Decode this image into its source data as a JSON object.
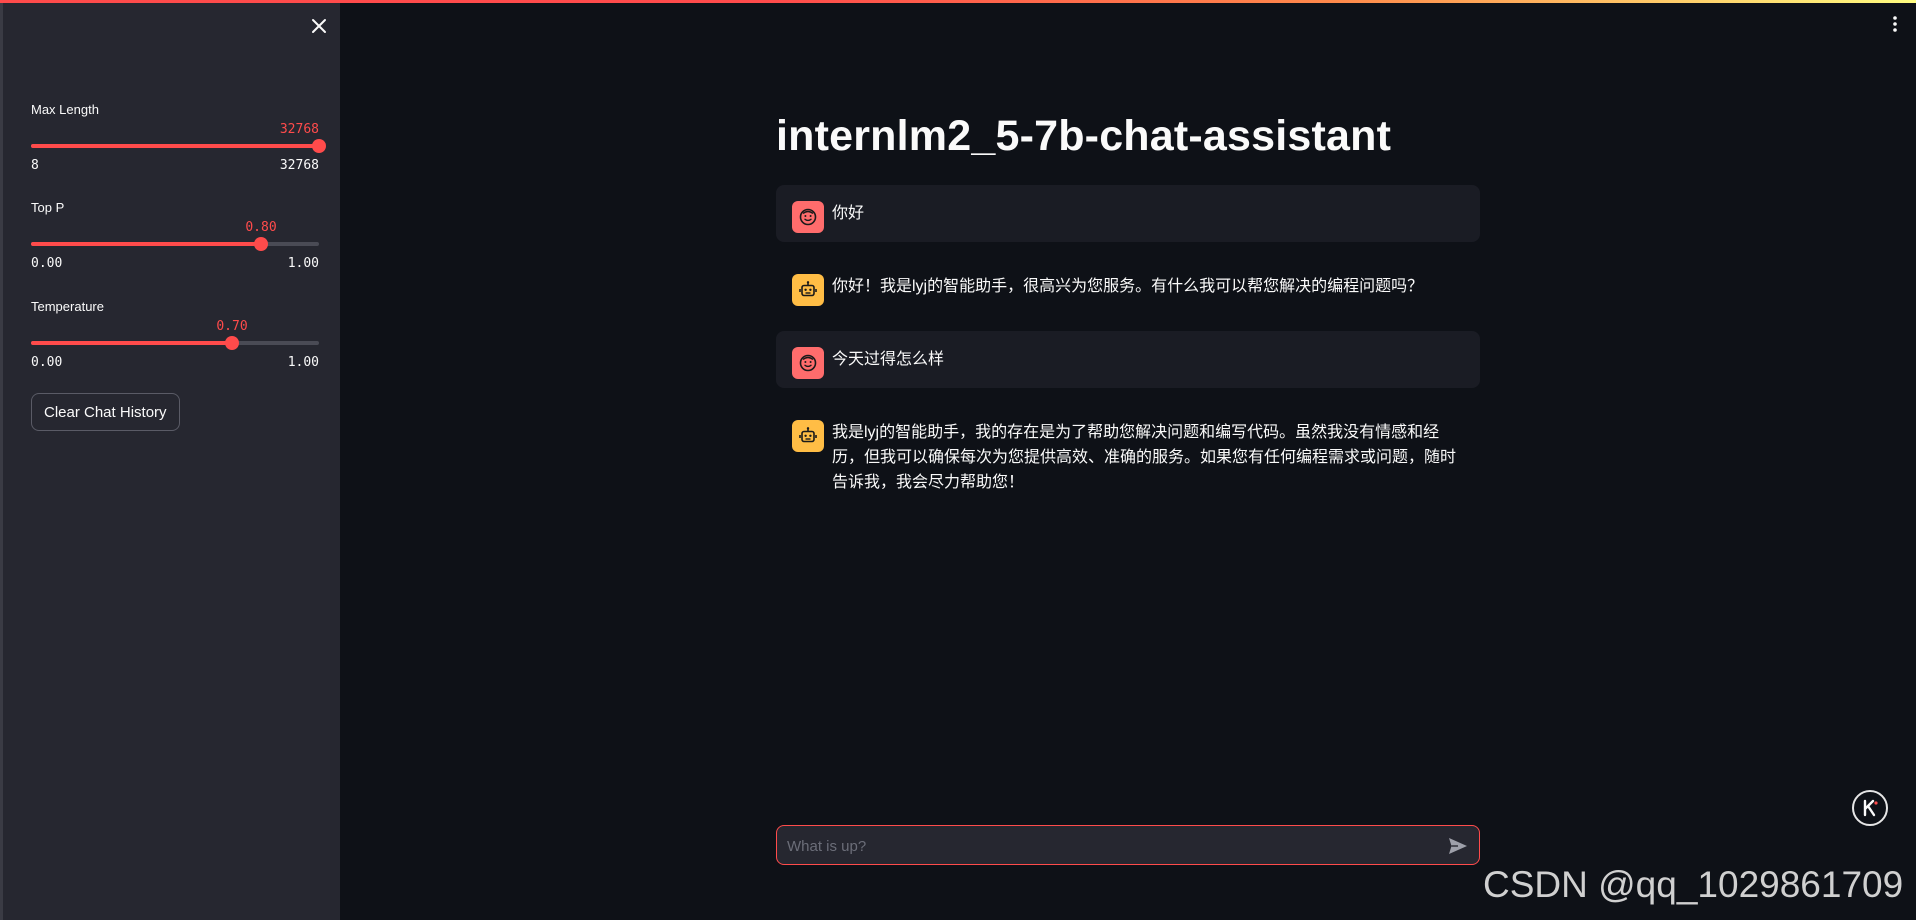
{
  "app": {
    "title": "internlm2_5-7b-chat-assistant",
    "accent_color": "#ff4b4b"
  },
  "sidebar": {
    "close_icon": "close-icon",
    "sliders": [
      {
        "id": "max-length",
        "label": "Max Length",
        "value": "32768",
        "min": "8",
        "max": "32768",
        "fraction": 1.0
      },
      {
        "id": "top-p",
        "label": "Top P",
        "value": "0.80",
        "min": "0.00",
        "max": "1.00",
        "fraction": 0.8
      },
      {
        "id": "temperature",
        "label": "Temperature",
        "value": "0.70",
        "min": "0.00",
        "max": "1.00",
        "fraction": 0.7
      }
    ],
    "clear_button_label": "Clear Chat History"
  },
  "messages": [
    {
      "role": "user",
      "avatar_icon": "user-face-icon",
      "text": "你好"
    },
    {
      "role": "assistant",
      "avatar_icon": "robot-icon",
      "text": "你好！我是lyj的智能助手，很高兴为您服务。有什么我可以帮您解决的编程问题吗？"
    },
    {
      "role": "user",
      "avatar_icon": "user-face-icon",
      "text": "今天过得怎么样"
    },
    {
      "role": "assistant",
      "avatar_icon": "robot-icon",
      "text": "我是lyj的智能助手，我的存在是为了帮助您解决问题和编写代码。虽然我没有情感和经历，但我可以确保每次为您提供高效、准确的服务。如果您有任何编程需求或问题，随时告诉我，我会尽力帮助您！"
    }
  ],
  "chat_input": {
    "placeholder": "What is up?",
    "value": "",
    "send_icon": "send-icon"
  },
  "header": {
    "menu_icon": "kebab-menu-icon"
  },
  "corner_badge_icon": "k-logo-icon",
  "watermark": "CSDN @qq_1029861709"
}
